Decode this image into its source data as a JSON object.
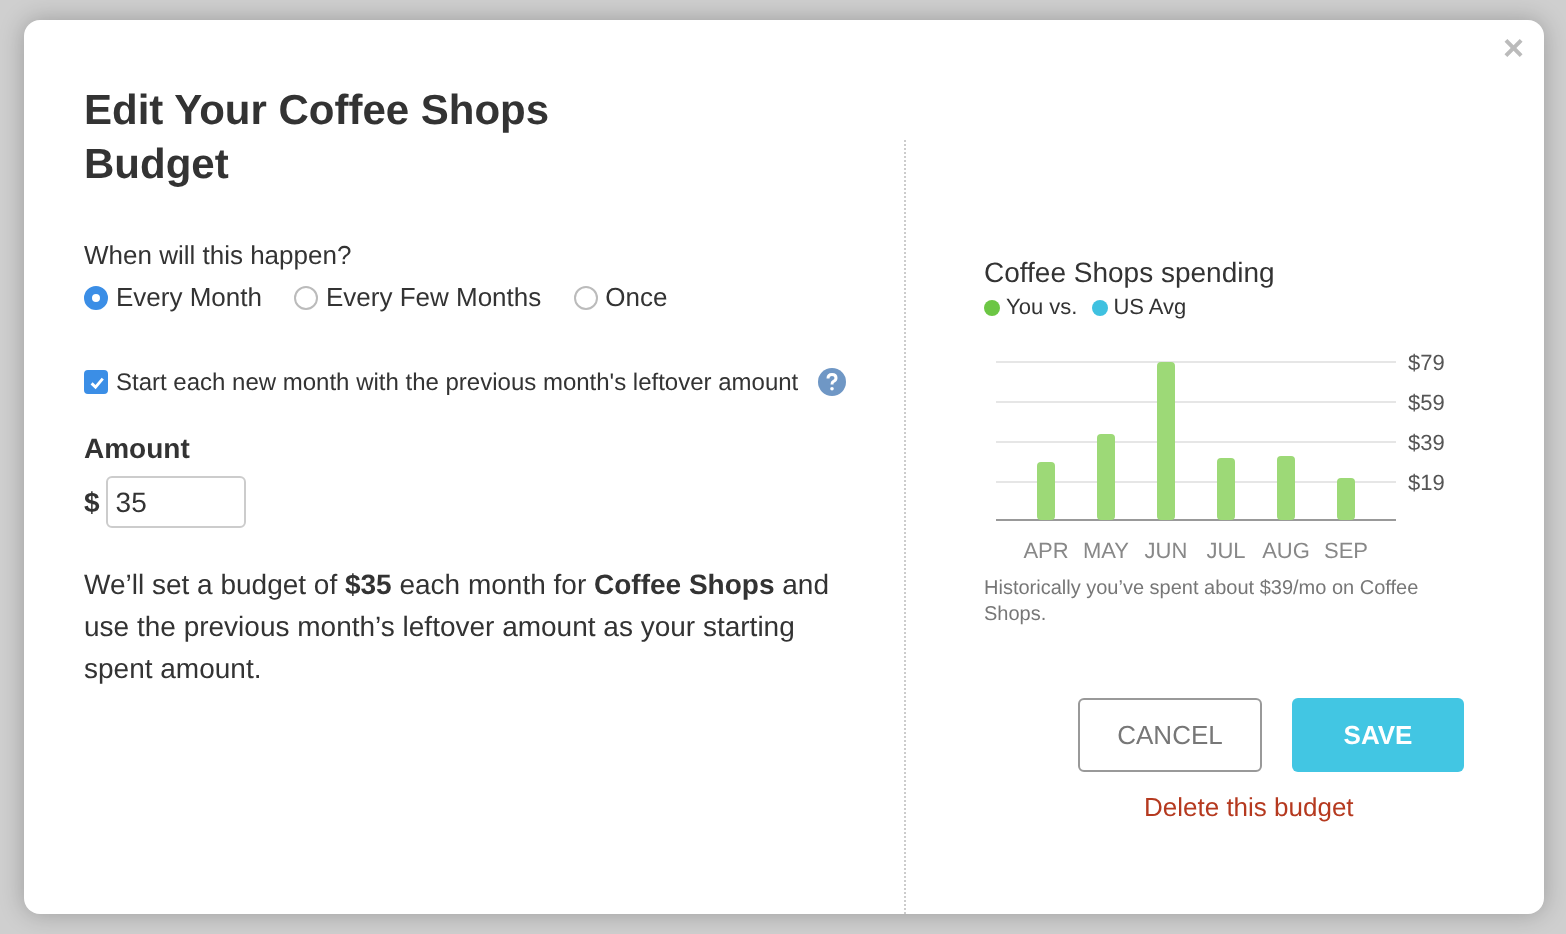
{
  "dialog": {
    "title": "Edit Your Coffee Shops Budget",
    "close": "×"
  },
  "frequency": {
    "question": "When will this happen?",
    "options": [
      {
        "label": "Every Month",
        "selected": true
      },
      {
        "label": "Every Few Months",
        "selected": false
      },
      {
        "label": "Once",
        "selected": false
      }
    ]
  },
  "rollover": {
    "label": "Start each new month with the previous month's leftover amount",
    "checked": true
  },
  "amount": {
    "label": "Amount",
    "currency": "$",
    "value": "35"
  },
  "summary": "We’ll set a budget of **$35** each month for **Coffee Shops** and use the previous month’s leftover amount as your starting spent amount.",
  "spending": {
    "title": "Coffee Shops spending",
    "legend": [
      {
        "label": "You vs.",
        "color": "#6cc644"
      },
      {
        "label": "US Avg",
        "color": "#3fc1e0"
      }
    ],
    "chart_data": {
      "type": "bar",
      "categories": [
        "APR",
        "MAY",
        "JUN",
        "JUL",
        "AUG",
        "SEP"
      ],
      "series": [
        {
          "color": "#9dd977",
          "values": [
            29,
            43,
            79,
            31,
            32,
            21
          ]
        }
      ],
      "grid": true,
      "ylim": [
        0,
        80
      ],
      "yticks": [
        {
          "value": 19,
          "label": "$19"
        },
        {
          "value": 39,
          "label": "$39"
        },
        {
          "value": 59,
          "label": "$59"
        },
        {
          "value": 79,
          "label": "$79"
        }
      ]
    },
    "note": "Historically you’ve spent about $39/mo on Coffee Shops."
  },
  "buttons": {
    "cancel": "CANCEL",
    "save": "SAVE",
    "delete": "Delete this budget"
  }
}
